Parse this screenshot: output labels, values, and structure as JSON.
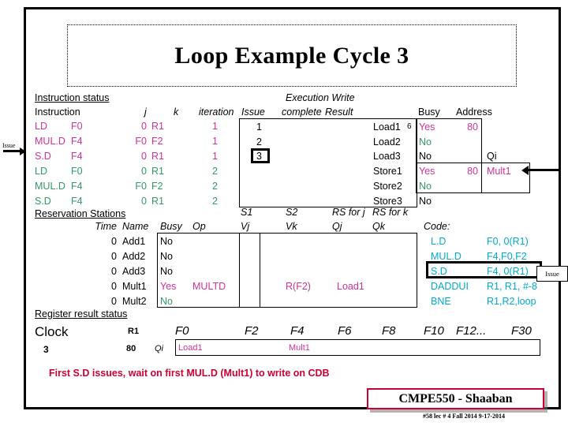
{
  "title": "Loop Example Cycle 3",
  "sections": {
    "instruction_status": "Instruction status",
    "reservation_stations": "Reservation Stations",
    "register_result_status": "Register result status",
    "code_label": "Code:"
  },
  "instruction_table": {
    "headers": [
      "Instruction",
      "j",
      "k",
      "iteration"
    ],
    "rows": [
      {
        "op": "LD",
        "dest": "F0",
        "j": "0",
        "k": "R1",
        "iteration": "1",
        "color": "magenta"
      },
      {
        "op": "MUL.D",
        "dest": "F4",
        "j": "F0",
        "k": "F2",
        "iteration": "1",
        "color": "magenta"
      },
      {
        "op": "S.D",
        "dest": "F4",
        "j": "0",
        "k": "R1",
        "iteration": "1",
        "color": "magenta"
      },
      {
        "op": "LD",
        "dest": "F0",
        "j": "0",
        "k": "R1",
        "iteration": "2",
        "color": "green"
      },
      {
        "op": "MUL.D",
        "dest": "F4",
        "j": "F0",
        "k": "F2",
        "iteration": "2",
        "color": "green"
      },
      {
        "op": "S.D",
        "dest": "F4",
        "j": "0",
        "k": "R1",
        "iteration": "2",
        "color": "green"
      }
    ]
  },
  "exec_table": {
    "header_top": "Execution Write",
    "headers": [
      "Issue",
      "complete",
      "Result"
    ],
    "issue_values": [
      "1",
      "2",
      "3"
    ],
    "highlighted_issue": "3",
    "complete_values": [
      "",
      "",
      ""
    ],
    "result_values": [
      "",
      "",
      ""
    ]
  },
  "load_store": {
    "headers": [
      "Busy",
      "Address"
    ],
    "qi_header": "Qi",
    "rows": [
      {
        "name": "Load1",
        "cycle": "6",
        "busy": "Yes",
        "address": "80",
        "qi": "",
        "color": "magenta"
      },
      {
        "name": "Load2",
        "cycle": "",
        "busy": "No",
        "address": "",
        "qi": "",
        "color": "green"
      },
      {
        "name": "Load3",
        "cycle": "",
        "busy": "No",
        "address": "",
        "qi": "",
        "color": "black"
      },
      {
        "name": "Store1",
        "cycle": "",
        "busy": "Yes",
        "address": "80",
        "qi": "Mult1",
        "color": "magenta"
      },
      {
        "name": "Store2",
        "cycle": "",
        "busy": "No",
        "address": "",
        "qi": "",
        "color": "green"
      },
      {
        "name": "Store3",
        "cycle": "",
        "busy": "No",
        "address": "",
        "qi": "",
        "color": "black"
      }
    ]
  },
  "rs_table": {
    "headers_top": [
      "S1",
      "S2",
      "RS for j",
      "RS for k"
    ],
    "headers": [
      "Time",
      "Name",
      "Busy",
      "Op",
      "Vj",
      "Vk",
      "Qj",
      "Qk"
    ],
    "rows": [
      {
        "time": "0",
        "name": "Add1",
        "busy": "No",
        "op": "",
        "vj": "",
        "vk": "",
        "qj": "",
        "qk": "",
        "color": "black"
      },
      {
        "time": "0",
        "name": "Add2",
        "busy": "No",
        "op": "",
        "vj": "",
        "vk": "",
        "qj": "",
        "qk": "",
        "color": "black"
      },
      {
        "time": "0",
        "name": "Add3",
        "busy": "No",
        "op": "",
        "vj": "",
        "vk": "",
        "qj": "",
        "qk": "",
        "color": "black"
      },
      {
        "time": "0",
        "name": "Mult1",
        "busy": "Yes",
        "op": "MULTD",
        "vj": "",
        "vk": "R(F2)",
        "qj": "Load1",
        "qk": "",
        "color": "magenta"
      },
      {
        "time": "0",
        "name": "Mult2",
        "busy": "No",
        "op": "",
        "vj": "",
        "vk": "",
        "qj": "",
        "qk": "",
        "color": "green"
      }
    ]
  },
  "code": {
    "lines": [
      {
        "op": "L.D",
        "args": "F0, 0(R1)"
      },
      {
        "op": "MUL.D",
        "args": "F4,F0,F2"
      },
      {
        "op": "S.D",
        "args": "F4, 0(R1)"
      },
      {
        "op": "DADDUI",
        "args": "R1, R1, #-8"
      },
      {
        "op": "BNE",
        "args": "R1,R2,loop"
      }
    ],
    "highlighted_line": "S.D"
  },
  "register_status": {
    "clock_label": "Clock",
    "clock_value": "3",
    "r1_label": "R1",
    "r1_value": "80",
    "qi_label": "Qi",
    "registers": [
      "F0",
      "F2",
      "F4",
      "F6",
      "F8",
      "F10",
      "F12...",
      "F30"
    ],
    "values": [
      "Load1",
      "",
      "Mult1",
      "",
      "",
      "",
      "",
      ""
    ]
  },
  "annotations": {
    "issue_left": "Issue",
    "issue_code": "Issue"
  },
  "caption": "First  S.D  issues,  wait on first MUL.D  (Mult1) to write on CDB",
  "footer": {
    "brand": "CMPE550 - Shaaban",
    "sub": "#58   lec # 4  Fall 2014   9-17-2014"
  },
  "colors": {
    "magenta": "#CC3399",
    "green": "#339966",
    "cyan": "#00AACC",
    "red": "#CC0033"
  }
}
